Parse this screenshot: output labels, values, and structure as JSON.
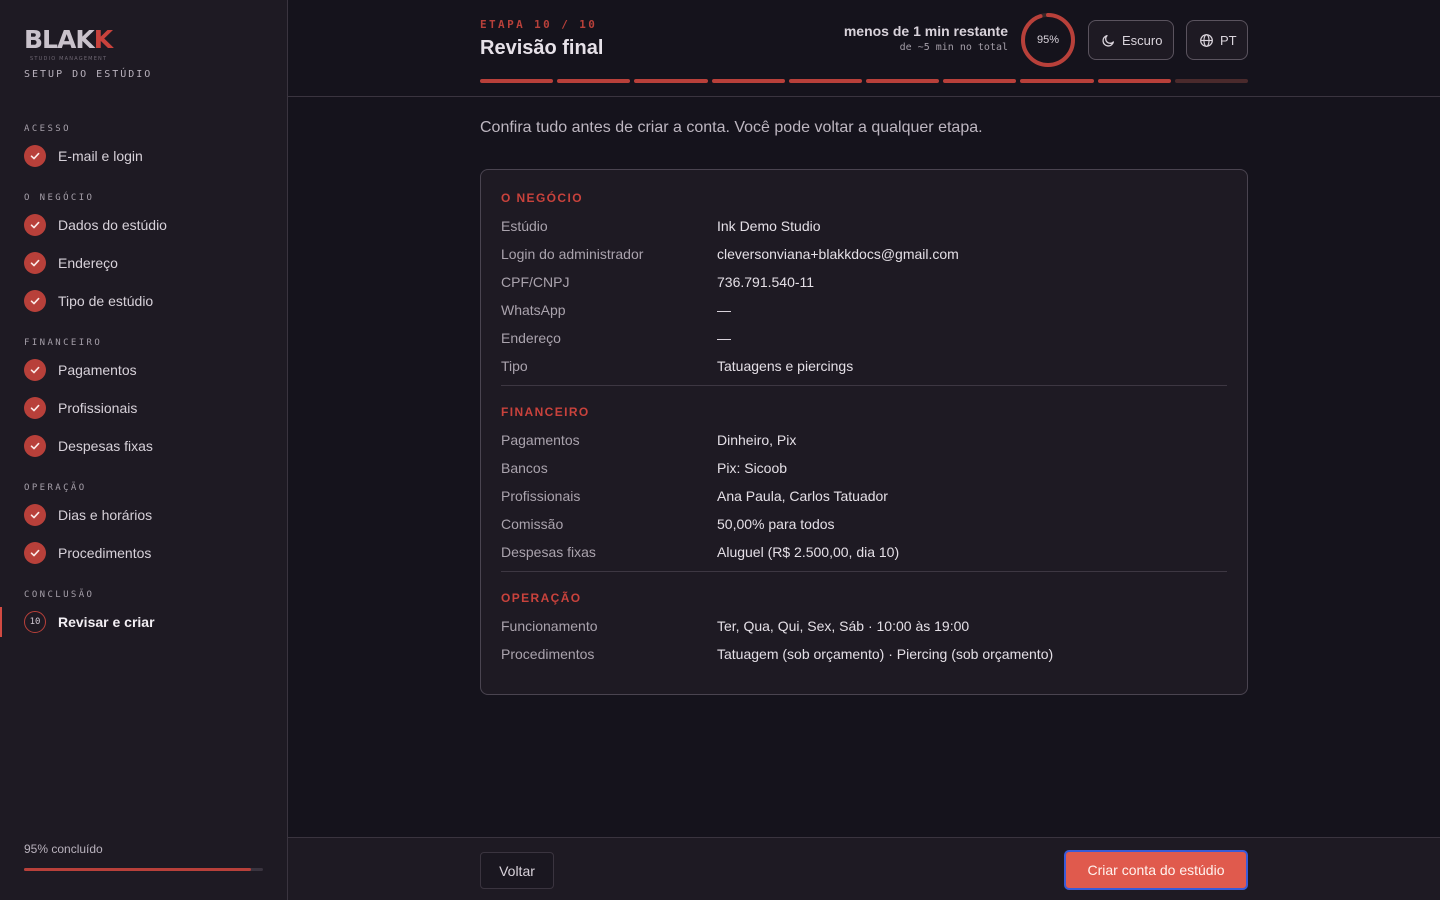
{
  "brand": {
    "logo": "BLAKK",
    "logo_sub": "STUDIO MANAGEMENT",
    "setup_label": "SETUP DO ESTÚDIO"
  },
  "sidebar": {
    "sections": [
      {
        "title": "ACESSO",
        "items": [
          {
            "label": "E-mail e login"
          }
        ]
      },
      {
        "title": "O NEGÓCIO",
        "items": [
          {
            "label": "Dados do estúdio"
          },
          {
            "label": "Endereço"
          },
          {
            "label": "Tipo de estúdio"
          }
        ]
      },
      {
        "title": "FINANCEIRO",
        "items": [
          {
            "label": "Pagamentos"
          },
          {
            "label": "Profissionais"
          },
          {
            "label": "Despesas fixas"
          }
        ]
      },
      {
        "title": "OPERAÇÃO",
        "items": [
          {
            "label": "Dias e horários"
          },
          {
            "label": "Procedimentos"
          }
        ]
      },
      {
        "title": "CONCLUSÃO",
        "items": [
          {
            "label": "Revisar e criar",
            "number": "10"
          }
        ]
      }
    ],
    "progress_label": "95% concluído",
    "progress_value": 0.95
  },
  "header": {
    "step_label": "ETAPA 10 / 10",
    "title": "Revisão final",
    "time_main": "menos de 1 min restante",
    "time_sub": "de ~5 min no total",
    "progress_percent": "95%",
    "progress_value": 0.95,
    "theme_label": "Escuro",
    "lang_label": "PT",
    "segments_done": 9,
    "segments_total": 10
  },
  "main": {
    "intro": "Confira tudo antes de criar a conta. Você pode voltar a qualquer etapa.",
    "sections": [
      {
        "title": "O NEGÓCIO",
        "rows": [
          {
            "key": "Estúdio",
            "value": "Ink Demo Studio"
          },
          {
            "key": "Login do administrador",
            "value": "cleversonviana+blakkdocs@gmail.com"
          },
          {
            "key": "CPF/CNPJ",
            "value": "736.791.540-11"
          },
          {
            "key": "WhatsApp",
            "value": "—"
          },
          {
            "key": "Endereço",
            "value": "—"
          },
          {
            "key": "Tipo",
            "value": "Tatuagens e piercings"
          }
        ]
      },
      {
        "title": "FINANCEIRO",
        "rows": [
          {
            "key": "Pagamentos",
            "value": "Dinheiro, Pix"
          },
          {
            "key": "Bancos",
            "value": "Pix: Sicoob"
          },
          {
            "key": "Profissionais",
            "value": "Ana Paula, Carlos Tatuador"
          },
          {
            "key": "Comissão",
            "value": "50,00% para todos"
          },
          {
            "key": "Despesas fixas",
            "value": "Aluguel (R$ 2.500,00, dia 10)"
          }
        ]
      },
      {
        "title": "OPERAÇÃO",
        "rows": [
          {
            "key": "Funcionamento",
            "value": "Ter, Qua, Qui, Sex, Sáb · 10:00 às 19:00"
          },
          {
            "key": "Procedimentos",
            "value": "Tatuagem (sob orçamento) · Piercing (sob orçamento)"
          }
        ]
      }
    ]
  },
  "footer": {
    "back_label": "Voltar",
    "create_label": "Criar conta do estúdio"
  },
  "colors": {
    "accent": "#b8403a",
    "primary_button": "#e05a4d",
    "background": "#15131c",
    "panel": "#1e1a23"
  }
}
